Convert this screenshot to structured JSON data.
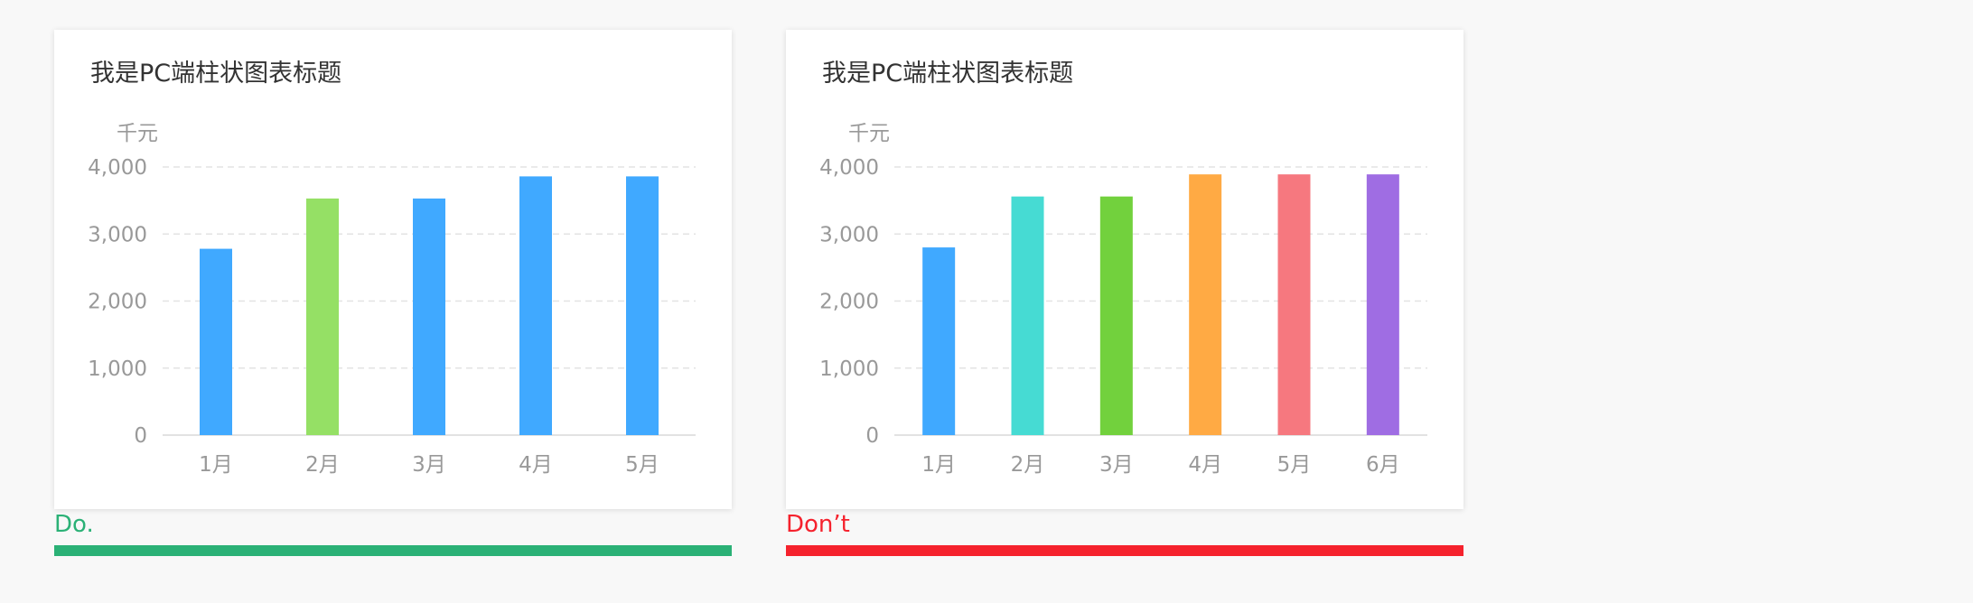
{
  "colors": {
    "do": "#2bb176",
    "dont": "#f5222d",
    "axis_text": "#999999",
    "grid": "#e3e3e3",
    "axis_line": "#d9d9d9"
  },
  "chart_data": [
    {
      "type": "bar",
      "title": "我是PC端柱状图表标题",
      "unit_label": "千元",
      "categories": [
        "1月",
        "2月",
        "3月",
        "4月",
        "5月"
      ],
      "values": [
        2780,
        3530,
        3530,
        3860,
        3860
      ],
      "bar_colors": [
        "#40a9ff",
        "#95e065",
        "#40a9ff",
        "#40a9ff",
        "#40a9ff"
      ],
      "ylim": [
        0,
        4000
      ],
      "yticks": [
        0,
        1000,
        2000,
        3000,
        4000
      ],
      "ytick_labels": [
        "0",
        "1,000",
        "2,000",
        "3,000",
        "4,000"
      ],
      "grid": true
    },
    {
      "type": "bar",
      "title": "我是PC端柱状图表标题",
      "unit_label": "千元",
      "categories": [
        "1月",
        "2月",
        "3月",
        "4月",
        "5月",
        "6月"
      ],
      "values": [
        2800,
        3560,
        3560,
        3890,
        3890,
        3890
      ],
      "bar_colors": [
        "#40a9ff",
        "#46dbd3",
        "#72d13d",
        "#ffaa44",
        "#f6787f",
        "#9f6de3"
      ],
      "ylim": [
        0,
        4000
      ],
      "yticks": [
        0,
        1000,
        2000,
        3000,
        4000
      ],
      "ytick_labels": [
        "0",
        "1,000",
        "2,000",
        "3,000",
        "4,000"
      ],
      "grid": true
    }
  ],
  "labels": {
    "do": "Do.",
    "dont": "Don’t"
  }
}
